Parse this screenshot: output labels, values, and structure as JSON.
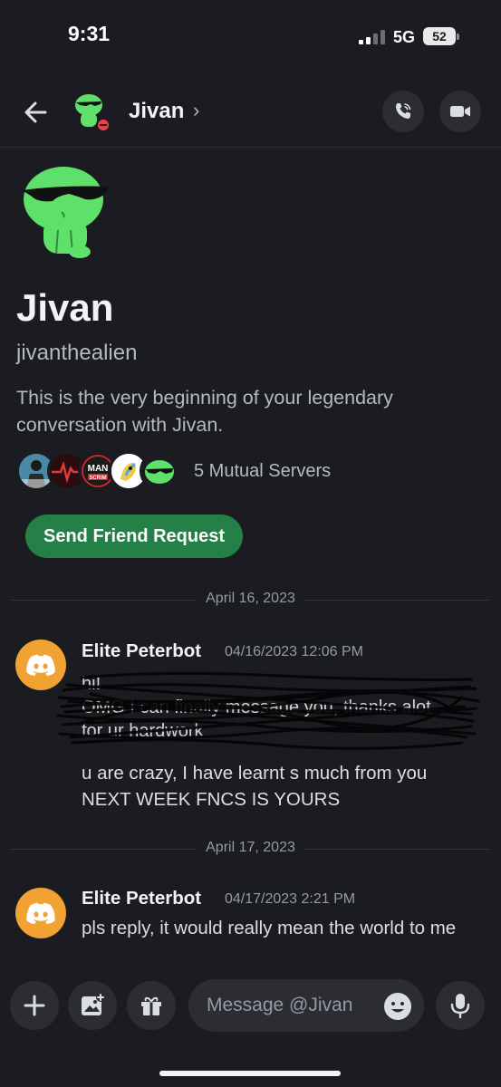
{
  "status_bar": {
    "time": "9:31",
    "network": "5G",
    "battery": "52"
  },
  "header": {
    "name": "Jivan",
    "chevron": "›"
  },
  "intro": {
    "name": "Jivan",
    "handle": "jivanthealien",
    "description": "This is the very beginning of your legendary conversation with Jivan.",
    "mutual_servers": "5 Mutual Servers",
    "friend_button": "Send Friend Request",
    "server_labels": [
      "MAN",
      "SCRIM"
    ]
  },
  "messages": {
    "date1": "April 16, 2023",
    "msg1": {
      "author": "Elite Peterbot",
      "time": "04/16/2023 12:06 PM",
      "scribbled_lines": [
        "hi!",
        "OMG I can finally message you, thanks alot",
        "for ur hardwork"
      ],
      "line1": "u are crazy, I have learnt s much from you",
      "line2": "NEXT WEEK FNCS IS YOURS"
    },
    "date2": "April 17, 2023",
    "msg2": {
      "author": "Elite Peterbot",
      "time": "04/17/2023 2:21 PM",
      "text": "pls reply, it would really mean the world to me"
    }
  },
  "composer": {
    "placeholder": "Message @Jivan"
  },
  "colors": {
    "background": "#1b1c21",
    "friend_button": "#248046",
    "bot_avatar": "#f0a232",
    "alien_green": "#5fe06b"
  },
  "icons": [
    "back-arrow-icon",
    "phone-icon",
    "video-camera-icon",
    "plus-icon",
    "image-icon",
    "gift-icon",
    "emoji-icon",
    "microphone-icon",
    "discord-logo-icon",
    "dnd-status-icon"
  ]
}
